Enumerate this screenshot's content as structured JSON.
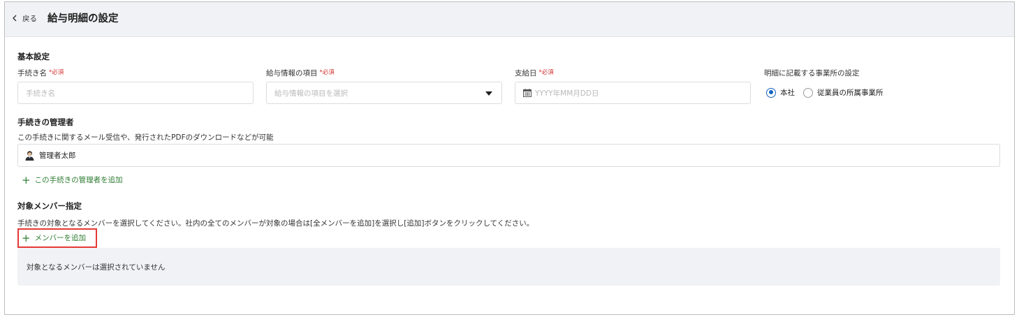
{
  "header": {
    "back_label": "戻る",
    "title": "給与明細の設定"
  },
  "basic": {
    "section_title": "基本設定",
    "required_mark": "*必須",
    "procedure_name": {
      "label": "手続き名",
      "placeholder": "手続き名"
    },
    "salary_item": {
      "label": "給与情報の項目",
      "placeholder": "給与情報の項目を選択"
    },
    "pay_date": {
      "label": "支給日",
      "placeholder": "YYYY年MM月DD日"
    },
    "office_setting": {
      "label": "明細に記載する事業所の設定",
      "options": [
        "本社",
        "従業員の所属事業所"
      ],
      "selected": "本社"
    }
  },
  "admins": {
    "section_title": "手続きの管理者",
    "description": "この手続きに関するメール受信や、発行されたPDFのダウンロードなどが可能",
    "admin_name": "管理者太郎",
    "add_label": "この手続きの管理者を追加"
  },
  "members": {
    "section_title": "対象メンバー指定",
    "description": "手続きの対象となるメンバーを選択してください。社内の全てのメンバーが対象の場合は[全メンバーを追加]を選択し[追加]ボタンをクリックしてください。",
    "add_label": "メンバーを追加",
    "empty_message": "対象となるメンバーは選択されていません"
  },
  "colors": {
    "accent_green": "#2e7d32",
    "radio_blue": "#1565c0",
    "required_red": "#d32f2f",
    "highlight_red": "#e53935"
  }
}
